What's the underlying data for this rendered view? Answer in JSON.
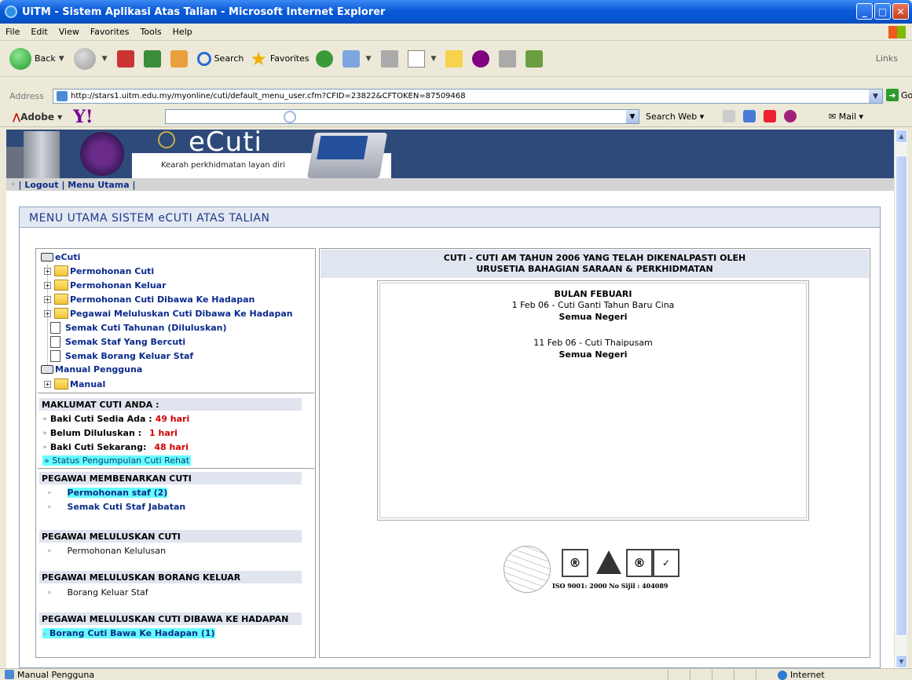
{
  "window": {
    "title": "UiTM - Sistem Aplikasi Atas Talian - Microsoft Internet Explorer"
  },
  "menu": [
    "File",
    "Edit",
    "View",
    "Favorites",
    "Tools",
    "Help"
  ],
  "toolbar": {
    "back": "Back",
    "search": "Search",
    "favorites": "Favorites",
    "links": "Links"
  },
  "address": {
    "label": "Address",
    "url": "http://stars1.uitm.edu.my/myonline/cuti/default_menu_user.cfm?CFID=23822&CFTOKEN=87509468",
    "go": "Go"
  },
  "yahoo_bar": {
    "adobe": "Adobe",
    "search_web": "Search Web",
    "mail": "Mail"
  },
  "banner": {
    "title": "eCuti",
    "tagline": "Kearah perkhidmatan layan diri"
  },
  "topnav": {
    "logout": "| Logout",
    "menu": "| Menu Utama |"
  },
  "page": {
    "main_title": "MENU UTAMA SISTEM eCUTI ATAS TALIAN"
  },
  "tree": {
    "root": "eCuti",
    "items": [
      "Permohonan Cuti",
      "Permohonan Keluar",
      "Permohonan Cuti Dibawa Ke Hadapan",
      "Pegawai Meluluskan Cuti Dibawa Ke Hadapan"
    ],
    "docs": [
      "Semak Cuti Tahunan (Diluluskan)",
      "Semak Staf Yang Bercuti",
      "Semak Borang Keluar Staf"
    ],
    "manual_root": "Manual Pengguna",
    "manual": "Manual"
  },
  "info": {
    "header": "MAKLUMAT CUTI ANDA :",
    "baki_label": "Baki Cuti Sedia Ada :",
    "baki_value": "49 hari",
    "belum_label": "Belum Diluluskan :",
    "belum_value": "1 hari",
    "sekarang_label": "Baki Cuti Sekarang:",
    "sekarang_value": "48 hari",
    "status_link": "Status Pengumpulan Cuti Rehat"
  },
  "pegawai": {
    "membenarkan_hdr": "PEGAWAI MEMBENARKAN CUTI",
    "permohonan_staf": "Permohonan staf (2)",
    "semak_staf": "Semak Cuti Staf Jabatan",
    "meluluskan_hdr": "PEGAWAI MELULUSKAN CUTI",
    "kelulusan": "Permohonan Kelulusan",
    "borang_hdr": "PEGAWAI MELULUSKAN BORANG KELUAR",
    "borang": "Borang Keluar Staf",
    "hadapan_hdr": "PEGAWAI MELULUSKAN CUTI DIBAWA KE HADAPAN",
    "hadapan": "Borang Cuti Bawa Ke Hadapan  (1)"
  },
  "holidays": {
    "header_l1": "CUTI - CUTI AM TAHUN 2006 YANG TELAH DIKENALPASTI OLEH",
    "header_l2": "URUSETIA BAHAGIAN SARAAN & PERKHIDMATAN",
    "month": "BULAN FEBUARI",
    "h1": "1 Feb 06 - Cuti Ganti Tahun Baru Cina",
    "h1_scope": "Semua Negeri",
    "h2": "11 Feb 06 - Cuti Thaipusam",
    "h2_scope": "Semua Negeri"
  },
  "iso": {
    "text": "ISO 9001: 2000  No Sijil : 404089"
  },
  "status": {
    "text": "Manual Pengguna",
    "zone": "Internet"
  }
}
